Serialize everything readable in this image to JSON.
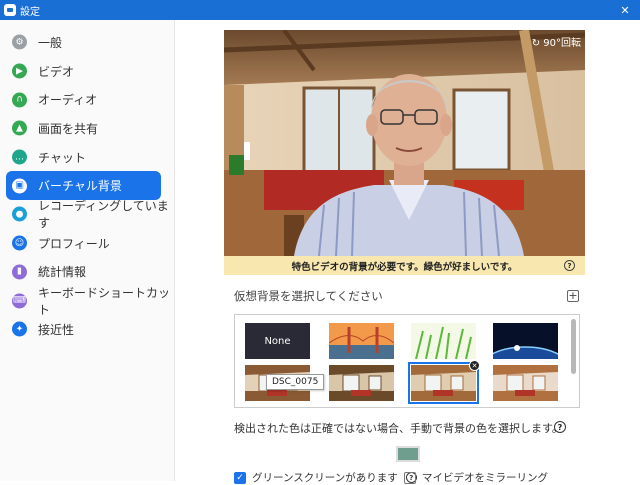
{
  "window": {
    "title": "設定",
    "close_label": "✕"
  },
  "sidebar": {
    "items": [
      {
        "label": "一般",
        "icon": "gear-icon",
        "color": "#9aa0a6"
      },
      {
        "label": "ビデオ",
        "icon": "video-icon",
        "color": "#34a853"
      },
      {
        "label": "オーディオ",
        "icon": "headphones-icon",
        "color": "#34a853"
      },
      {
        "label": "画面を共有",
        "icon": "share-screen-icon",
        "color": "#34a853"
      },
      {
        "label": "チャット",
        "icon": "chat-icon",
        "color": "#1fa58a"
      },
      {
        "label": "バーチャル背景",
        "icon": "virtual-background-icon",
        "color": "#1a73e8"
      },
      {
        "label": "レコーディングしています",
        "icon": "record-icon",
        "color": "#1a9fd8"
      },
      {
        "label": "プロフィール",
        "icon": "profile-icon",
        "color": "#1a73e8"
      },
      {
        "label": "統計情報",
        "icon": "stats-icon",
        "color": "#8e6bd8"
      },
      {
        "label": "キーボードショートカット",
        "icon": "keyboard-icon",
        "color": "#8e6bd8"
      },
      {
        "label": "接近性",
        "icon": "accessibility-icon",
        "color": "#1a73e8"
      }
    ]
  },
  "preview": {
    "rotate_label": "90°回転"
  },
  "notice": {
    "text": "特色ビデオの背景が必要です。緑色が好ましいです。",
    "help_symbol": "?"
  },
  "backgrounds": {
    "title": "仮想背景を選択してください",
    "add_symbol": "+",
    "items": [
      {
        "label": "None",
        "kind": "none"
      },
      {
        "label": "golden-gate-bridge",
        "kind": "bridge"
      },
      {
        "label": "grass",
        "kind": "grass"
      },
      {
        "label": "earth-from-space",
        "kind": "space"
      },
      {
        "label": "room-1",
        "kind": "room"
      },
      {
        "label": "room-2",
        "kind": "room2"
      },
      {
        "label": "room-3",
        "kind": "room3",
        "selected": true
      },
      {
        "label": "room-4",
        "kind": "room4"
      }
    ],
    "tooltip": "DSC_0075",
    "remove_symbol": "✕"
  },
  "detect": {
    "text": "検出された色は正確ではない場合、手動で背景の色を選択します。",
    "help_symbol": "?",
    "swatch_color": "#6f9e8e"
  },
  "options": {
    "green_screen_label": "グリーンスクリーンがあります",
    "green_screen_checked": true,
    "mirror_label": "マイビデオをミラーリング",
    "mirror_checked": false,
    "help_symbol": "?"
  },
  "colors": {
    "accent": "#1a73e8",
    "notice_bg": "#f8e8b0"
  }
}
